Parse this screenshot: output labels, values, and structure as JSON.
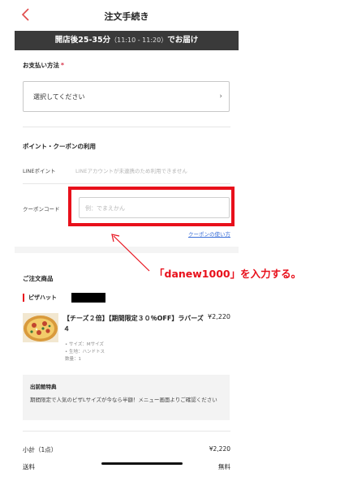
{
  "header": {
    "title": "注文手続き",
    "back_icon": "chevron-left-icon"
  },
  "delivery": {
    "label": "開店後25-35分",
    "times": "（11:10 - 11:20）",
    "suffix": "でお届け"
  },
  "payment": {
    "label": "お支払い方法",
    "required_mark": "*",
    "placeholder": "選択してください",
    "chevron": "›"
  },
  "points": {
    "section_title": "ポイント・クーポンの利用",
    "line_label": "LINEポイント",
    "line_note": "LINEアカウントが未連携のため利用できません",
    "coupon_label": "クーポンコード",
    "coupon_placeholder": "例：でまえかん",
    "coupon_link": "クーポンの使い方"
  },
  "annotation": {
    "text": "「danew1000」を入力する。"
  },
  "order": {
    "section_title": "ご注文商品",
    "store_name": "ピザハット",
    "item": {
      "name": "【チーズ２倍】【期間限定３０％OFF】ラバーズ４",
      "price": "¥2,220",
      "size": "• サイズ：Mサイズ",
      "crust": "• 生地：ハンドトス",
      "qty": "数量：1"
    },
    "campaign": {
      "title": "出前館特典",
      "body": "期間限定で人気のピザLサイズが今なら半額！メニュー画面よりご確認ください"
    }
  },
  "summary": {
    "subtotal_label": "小計（1点）",
    "subtotal_value": "¥2,220",
    "shipping_label": "送料",
    "shipping_value": "無料"
  },
  "colors": {
    "accent": "#e8101b",
    "link": "#3a6fd8",
    "bar": "#3a3a3a"
  }
}
